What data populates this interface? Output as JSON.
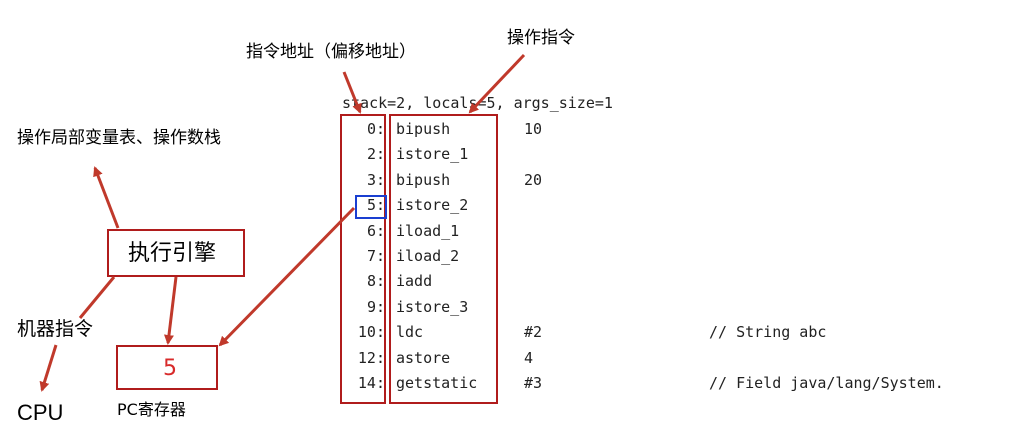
{
  "labels": {
    "instr_address": "指令地址（偏移地址）",
    "opcode": "操作指令",
    "operate_locals": "操作局部变量表、操作数栈",
    "execution_engine": "执行引擎",
    "machine_code": "机器指令",
    "cpu": "CPU",
    "pc_register": "PC寄存器",
    "pc_value": "5"
  },
  "header": "stack=2, locals=5, args_size=1",
  "bytecode": [
    {
      "offset": "0:",
      "op": "bipush",
      "arg": "10",
      "comment": ""
    },
    {
      "offset": "2:",
      "op": "istore_1",
      "arg": "",
      "comment": ""
    },
    {
      "offset": "3:",
      "op": "bipush",
      "arg": "20",
      "comment": ""
    },
    {
      "offset": "5:",
      "op": "istore_2",
      "arg": "",
      "comment": ""
    },
    {
      "offset": "6:",
      "op": "iload_1",
      "arg": "",
      "comment": ""
    },
    {
      "offset": "7:",
      "op": "iload_2",
      "arg": "",
      "comment": ""
    },
    {
      "offset": "8:",
      "op": "iadd",
      "arg": "",
      "comment": ""
    },
    {
      "offset": "9:",
      "op": "istore_3",
      "arg": "",
      "comment": ""
    },
    {
      "offset": "10:",
      "op": "ldc",
      "arg": "#2",
      "comment": "// String abc"
    },
    {
      "offset": "12:",
      "op": "astore",
      "arg": "4",
      "comment": ""
    },
    {
      "offset": "14:",
      "op": "getstatic",
      "arg": "#3",
      "comment": "// Field java/lang/System."
    }
  ],
  "colors": {
    "box_red": "#b01c1c",
    "arrow_red": "#c0392b",
    "highlight_blue": "#1a3fd1",
    "pc_text": "#d82a2a"
  }
}
